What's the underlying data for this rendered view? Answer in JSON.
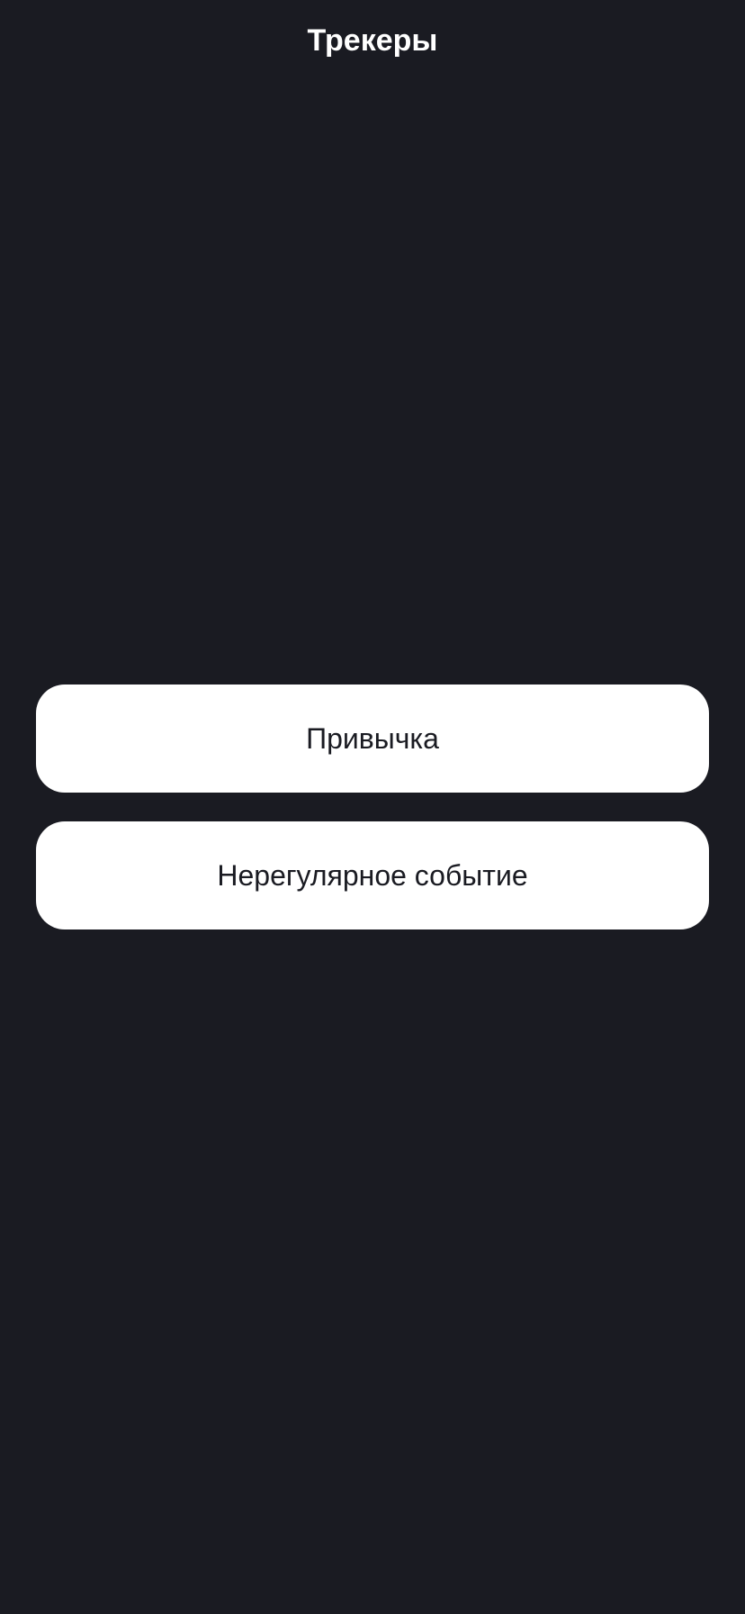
{
  "header": {
    "title": "Трекеры"
  },
  "options": [
    {
      "label": "Привычка"
    },
    {
      "label": "Нерегулярное событие"
    }
  ],
  "colors": {
    "background": "#1A1B22",
    "button": "#FFFFFF",
    "button_text": "#1A1B22"
  }
}
